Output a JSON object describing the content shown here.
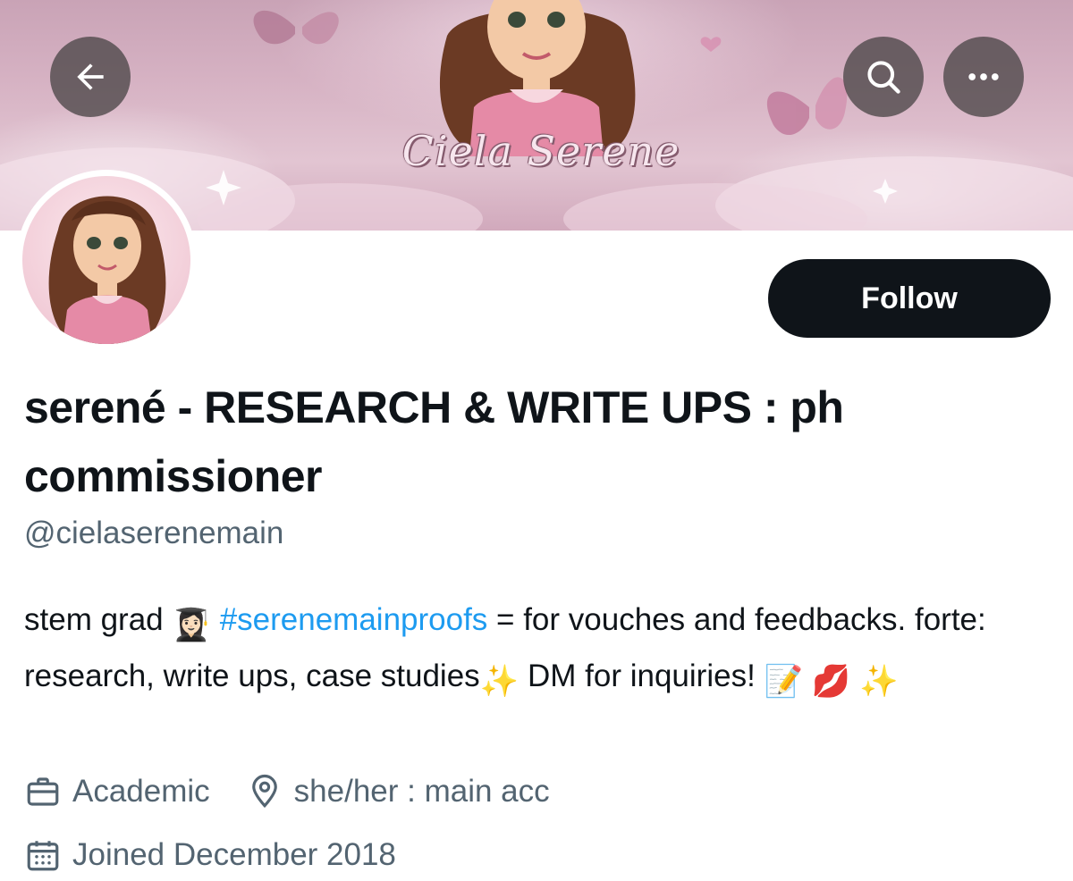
{
  "banner": {
    "title_text": "Ciela Serene"
  },
  "nav": {
    "back_icon": "arrow-left-icon",
    "search_icon": "search-icon",
    "more_icon": "more-horizontal-icon"
  },
  "profile": {
    "follow_label": "Follow",
    "display_name": "serené - RESEARCH & WRITE UPS : ph commissioner",
    "handle": "@cielaserenemain",
    "bio": {
      "part1": "stem grad",
      "emoji1": "👩🏻‍🎓",
      "hashtag": "#serenemainproofs",
      "part2": "= for vouches and feedbacks. forte: research, write ups, case studies",
      "emoji2": "✨",
      "part3": "DM for inquiries!",
      "emoji3": "📝",
      "emoji4": "💋",
      "emoji5": "✨"
    },
    "category": "Academic",
    "location": "she/her : main acc",
    "joined": "Joined December 2018"
  },
  "colors": {
    "text_primary": "#0f1419",
    "text_secondary": "#536471",
    "link": "#1d9bf0",
    "follow_bg": "#0f1419",
    "banner_pink": "#d6b2c3"
  }
}
